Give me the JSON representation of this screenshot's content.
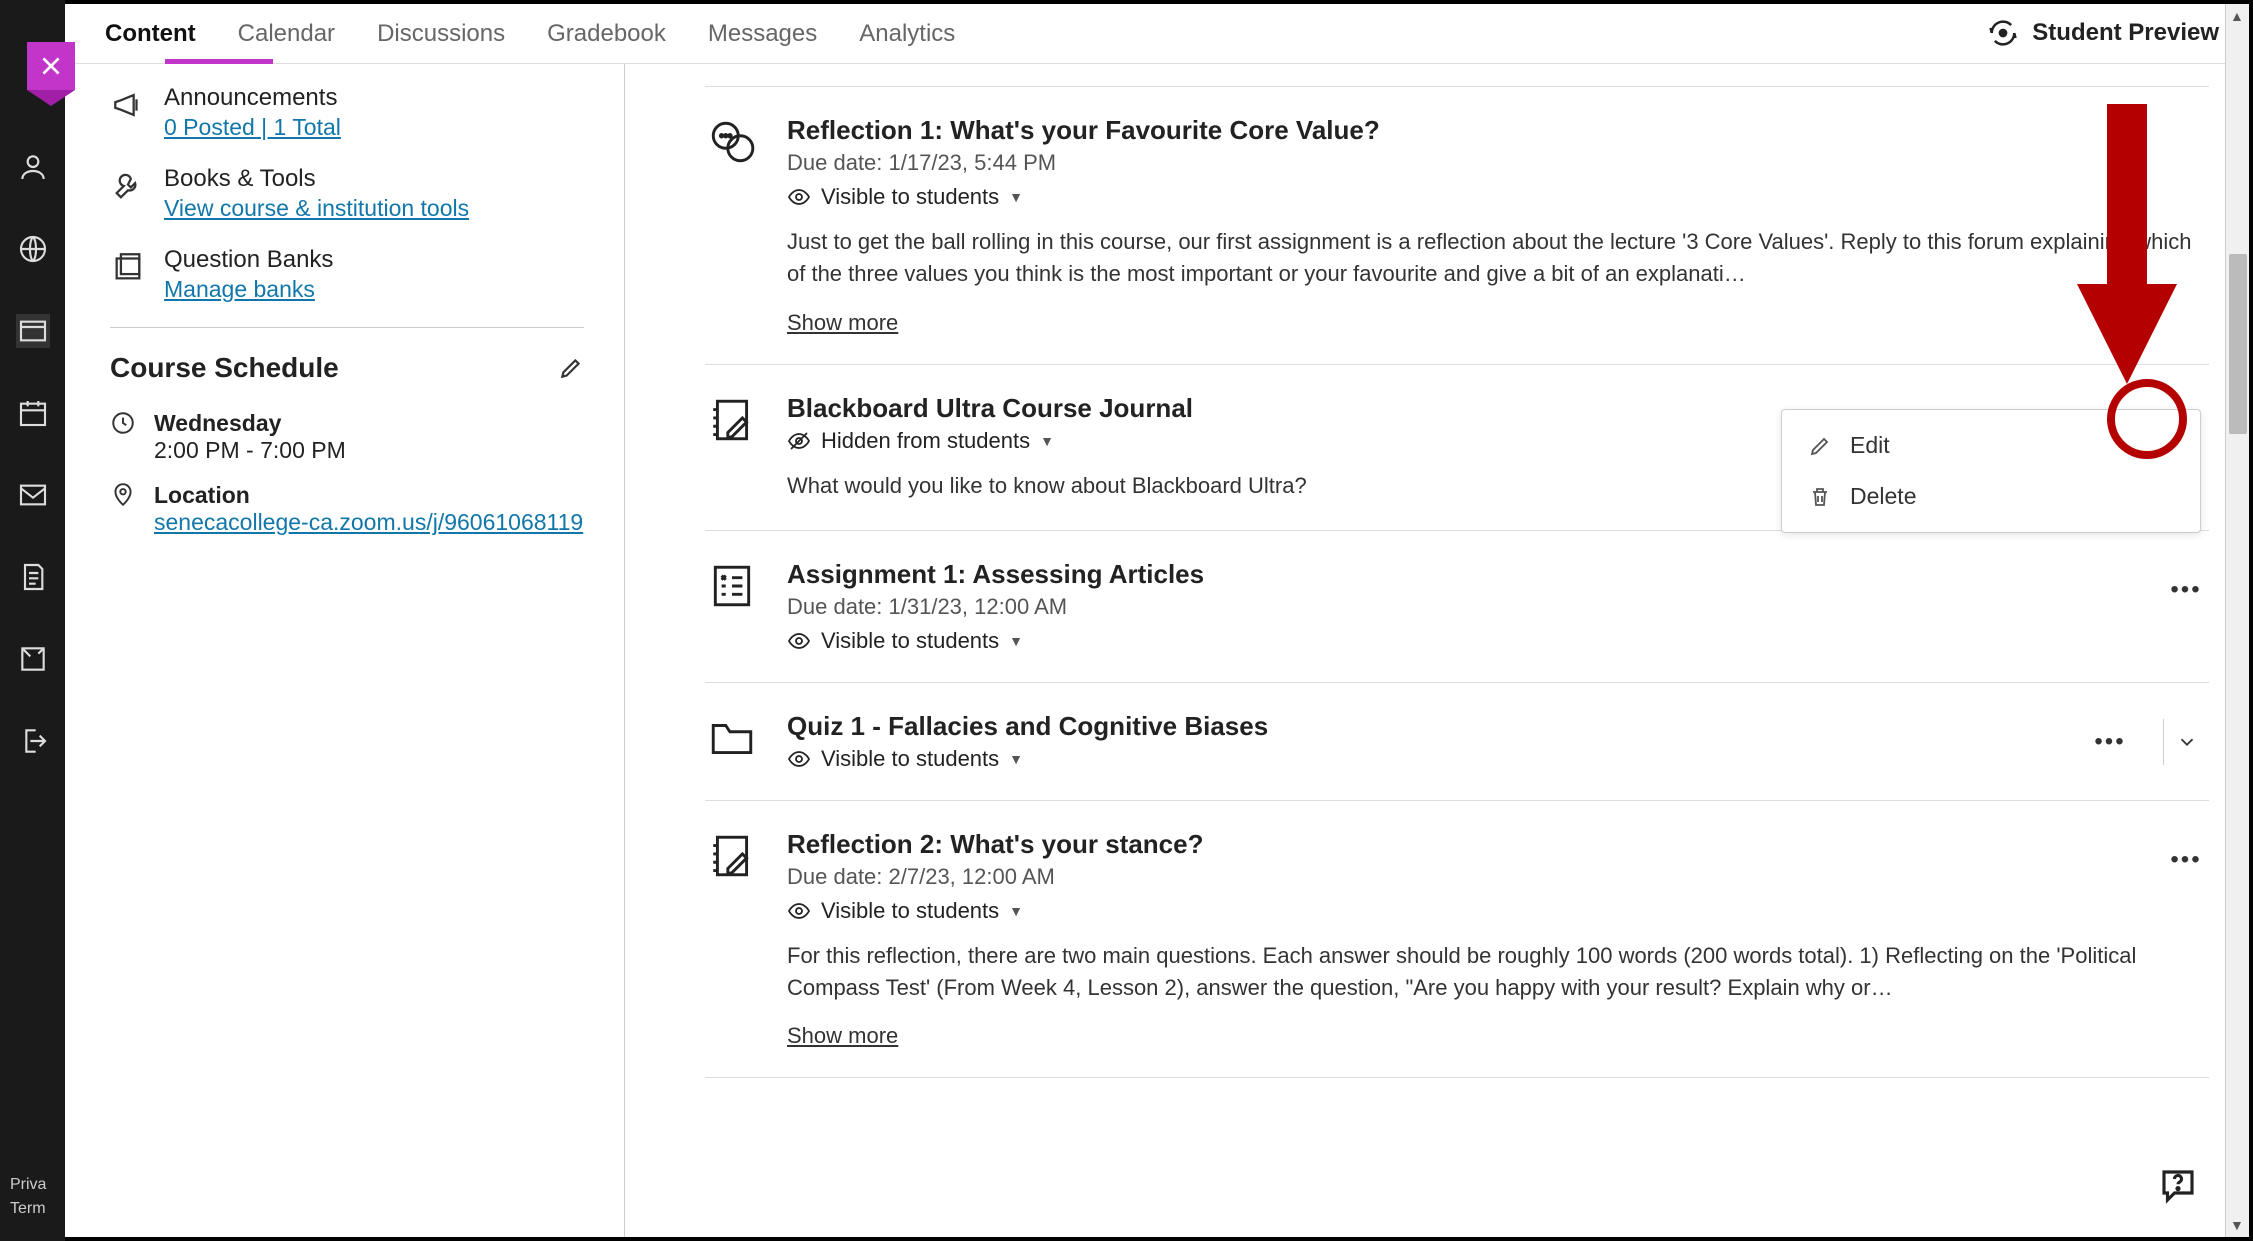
{
  "tabs": {
    "content": "Content",
    "calendar": "Calendar",
    "discussions": "Discussions",
    "gradebook": "Gradebook",
    "messages": "Messages",
    "analytics": "Analytics"
  },
  "student_preview": "Student Preview",
  "rail_footer": {
    "l1": "Priva",
    "l2": "Term"
  },
  "sidebar": {
    "announcements": {
      "title": "Announcements",
      "link": "0 Posted  |  1 Total"
    },
    "books": {
      "title": "Books & Tools",
      "link": "View course & institution tools"
    },
    "qbanks": {
      "title": "Question Banks",
      "link": "Manage banks"
    },
    "schedule": {
      "heading": "Course Schedule",
      "day_label": "Wednesday",
      "time": "2:00 PM - 7:00 PM",
      "loc_label": "Location",
      "loc_link": "senecacollege-ca.zoom.us/j/96061068119"
    }
  },
  "visibility": {
    "visible": "Visible to students",
    "hidden": "Hidden from students"
  },
  "show_more": "Show more",
  "menu": {
    "edit": "Edit",
    "delete": "Delete"
  },
  "items": [
    {
      "title": "Reflection 1: What's your Favourite Core Value?",
      "due": "Due date: 1/17/23, 5:44 PM",
      "vis": "visible",
      "desc": "Just to get the ball rolling in this course, our first assignment is a reflection about the lecture '3 Core Values'. Reply to this forum explaining which of the three values you think is the most important or your favourite and give a bit of an explanati…",
      "show_more": true
    },
    {
      "title": "Blackboard Ultra Course Journal",
      "due": "",
      "vis": "hidden",
      "desc": "What would you like to know about Blackboard Ultra?",
      "show_more": false
    },
    {
      "title": "Assignment 1: Assessing Articles",
      "due": "Due date: 1/31/23, 12:00 AM",
      "vis": "visible",
      "desc": "",
      "show_more": false
    },
    {
      "title": "Quiz 1 - Fallacies and Cognitive Biases",
      "due": "",
      "vis": "visible",
      "desc": "",
      "show_more": false,
      "folder": true
    },
    {
      "title": "Reflection 2: What's your stance?",
      "due": "Due date: 2/7/23, 12:00 AM",
      "vis": "visible",
      "desc": "For this reflection, there are two main questions. Each answer should be roughly 100 words (200 words total). 1) Reflecting on the 'Political Compass Test' (From Week 4, Lesson 2), answer the question, \"Are you happy with your result? Explain why or…",
      "show_more": true
    }
  ]
}
